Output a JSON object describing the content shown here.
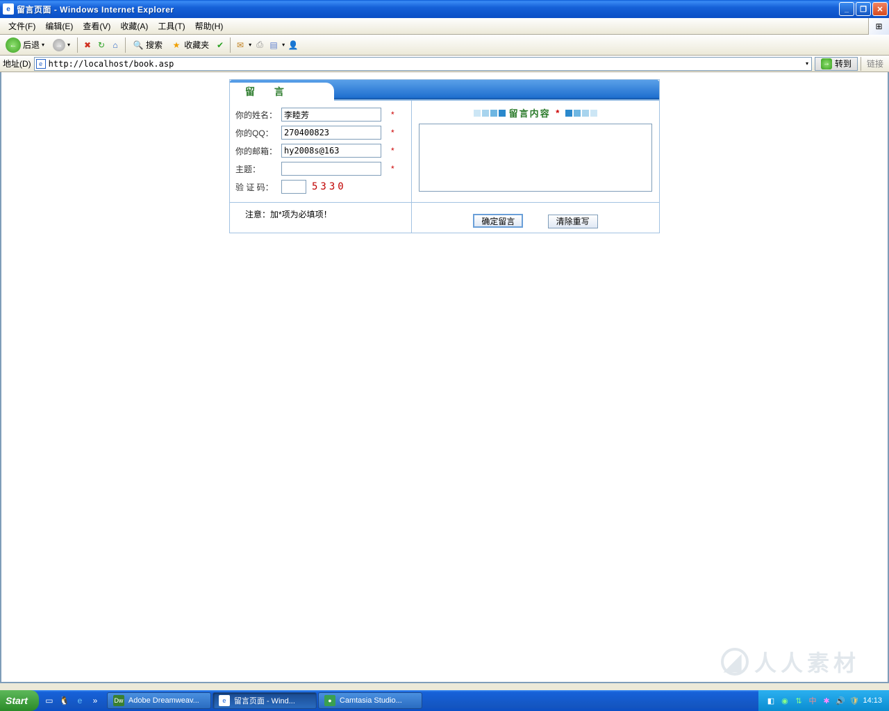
{
  "window": {
    "title": "留言页面 - Windows Internet Explorer"
  },
  "menu": {
    "file": "文件(F)",
    "edit": "编辑(E)",
    "view": "查看(V)",
    "favorites": "收藏(A)",
    "tools": "工具(T)",
    "help": "帮助(H)"
  },
  "toolbar": {
    "back": "后退",
    "search": "搜索",
    "favorites": "收藏夹"
  },
  "address": {
    "label": "地址(D)",
    "url": "http://localhost/book.asp",
    "go": "转到",
    "links": "链接"
  },
  "form": {
    "header": "留 言",
    "name_label": "你的姓名：",
    "name_value": "李睦芳",
    "qq_label": "你的QQ：",
    "qq_value": "270400823",
    "email_label": "你的邮箱：",
    "email_value": "hy2008s@163",
    "subject_label": "主题：",
    "subject_value": "",
    "captcha_label": "验 证 码：",
    "captcha_value": "5330",
    "note": "注意：加*项为必填项！",
    "content_title": "留言内容",
    "submit": "确定留言",
    "reset": "清除重写",
    "required_mark": "*"
  },
  "watermark": "人人素材",
  "taskbar": {
    "start": "Start",
    "task1": "Adobe Dreamweav...",
    "task2": "留言页面 - Wind...",
    "task3": "Camtasia Studio...",
    "clock": "14:13"
  }
}
